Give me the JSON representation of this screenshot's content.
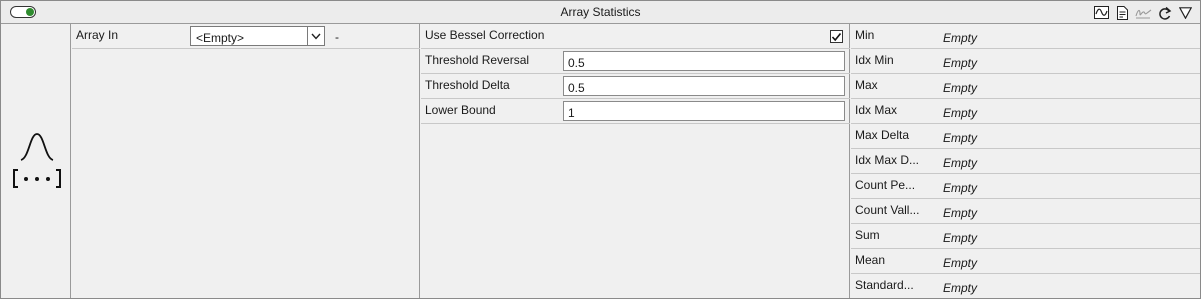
{
  "window": {
    "title": "Array Statistics"
  },
  "toolbar": {
    "icons": [
      "chart-icon",
      "document-icon",
      "signature-icon",
      "redo-icon",
      "filter-icon"
    ]
  },
  "node": {
    "icon": "array-statistics-node-icon"
  },
  "input": {
    "label": "Array In",
    "selected": "<Empty>",
    "suffix": "-"
  },
  "parameters": {
    "bessel": {
      "label": "Use Bessel Correction",
      "checked": true
    },
    "items": [
      {
        "label": "Threshold Reversal",
        "value": "0.5"
      },
      {
        "label": "Threshold Delta",
        "value": "0.5"
      },
      {
        "label": "Lower Bound",
        "value": "1"
      }
    ]
  },
  "outputs": [
    {
      "label": "Min",
      "value": "Empty"
    },
    {
      "label": "Idx Min",
      "value": "Empty"
    },
    {
      "label": "Max",
      "value": "Empty"
    },
    {
      "label": "Idx Max",
      "value": "Empty"
    },
    {
      "label": "Max Delta",
      "value": "Empty"
    },
    {
      "label": "Idx Max D...",
      "value": "Empty"
    },
    {
      "label": "Count Pe...",
      "value": "Empty"
    },
    {
      "label": "Count Vall...",
      "value": "Empty"
    },
    {
      "label": "Sum",
      "value": "Empty"
    },
    {
      "label": "Mean",
      "value": "Empty"
    },
    {
      "label": "Standard...",
      "value": "Empty"
    }
  ],
  "colors": {
    "toggle_on": "#2e8b2e",
    "background": "#f0f0f0"
  }
}
